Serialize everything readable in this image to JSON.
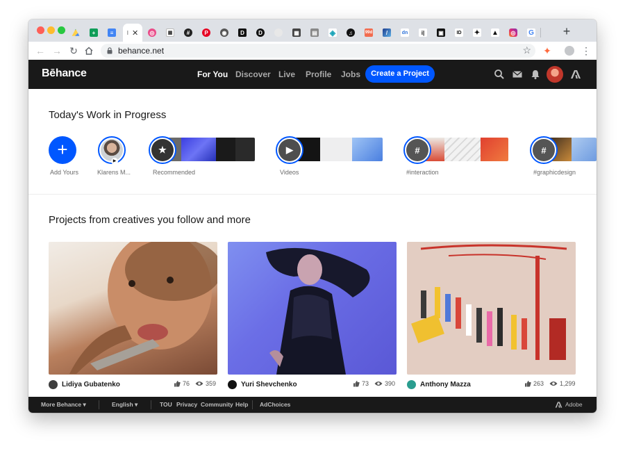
{
  "browser": {
    "url": "behance.net",
    "new_tab": "+"
  },
  "header": {
    "logo": "Bēhance",
    "nav": [
      "For You",
      "Discover",
      "Live",
      "Profile",
      "Jobs"
    ],
    "cta": "Create a Project",
    "icons": [
      "search-icon",
      "mail-icon",
      "bell-icon",
      "user-avatar",
      "adobe-icon"
    ]
  },
  "wip": {
    "title": "Today's Work in Progress",
    "add_label": "Add Yours",
    "items": [
      {
        "label": "Klarens M..."
      },
      {
        "label": "Recommended"
      },
      {
        "label": "Videos"
      },
      {
        "label": "#interaction"
      },
      {
        "label": "#graphicdesign"
      }
    ]
  },
  "projects": {
    "title": "Projects from creatives you follow and more",
    "cards": [
      {
        "owner": "Lidiya Gubatenko",
        "likes": "76",
        "views": "359"
      },
      {
        "owner": "Yuri Shevchenko",
        "likes": "73",
        "views": "390"
      },
      {
        "owner": "Anthony Mazza",
        "likes": "263",
        "views": "1,299"
      }
    ]
  },
  "footer": {
    "more": "More Behance ▾",
    "language": "English ▾",
    "links": [
      "TOU",
      "Privacy",
      "Community",
      "Help"
    ],
    "adchoices": "AdChoices",
    "adobe": "Adobe"
  },
  "colors": {
    "accent": "#0057ff",
    "header_bg": "#191919"
  }
}
